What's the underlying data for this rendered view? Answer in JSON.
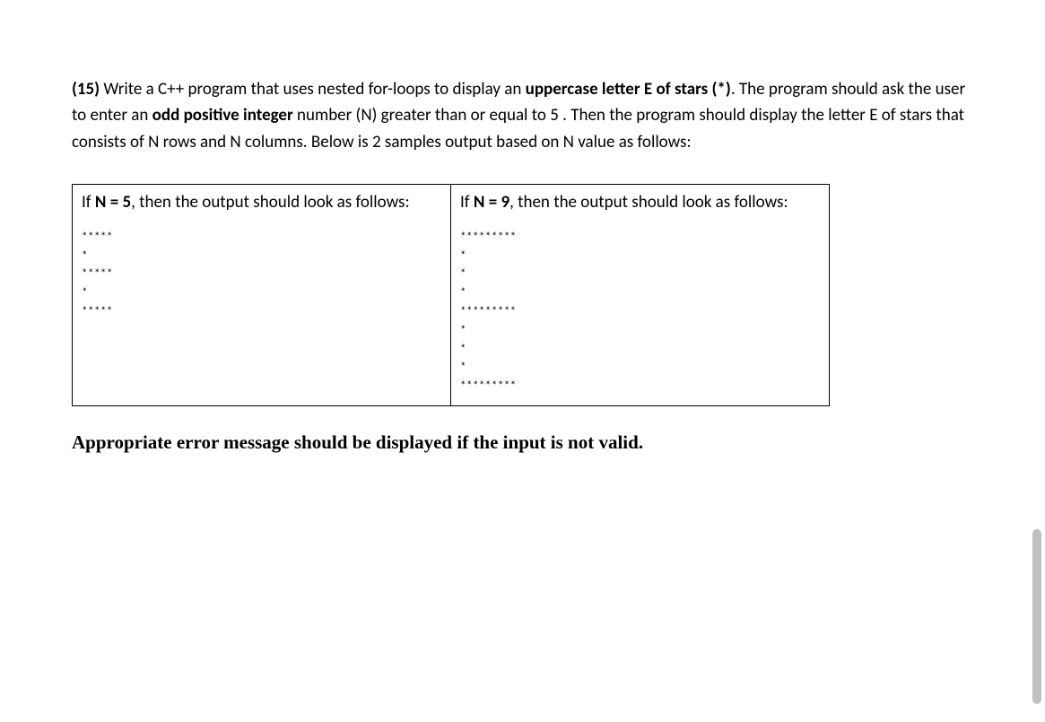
{
  "question": {
    "number": "(15)",
    "text_part1": " Write a C++ program that uses nested for-loops to display an ",
    "bold1": "uppercase letter E of stars (*)",
    "text_part2": ". The program should ask the user to enter an ",
    "bold2": "odd positive integer",
    "text_part3": " number (N) greater than or equal  to 5 . Then the program should display the letter E of stars that consists of N rows and N columns. Below is 2 samples output based on N value as follows:"
  },
  "examples": {
    "left": {
      "header_prefix": "If ",
      "header_bold": "N = 5",
      "header_suffix": ", then the output should look as follows:",
      "output": "*****\n*\n*****\n*\n*****"
    },
    "right": {
      "header_prefix": "If ",
      "header_bold": "N = 9",
      "header_suffix": ", then the output should look as follows:",
      "output": "*********\n*\n*\n*\n*********\n*\n*\n*\n*********"
    }
  },
  "error_note": "Appropriate error message should be displayed if the input is not valid."
}
